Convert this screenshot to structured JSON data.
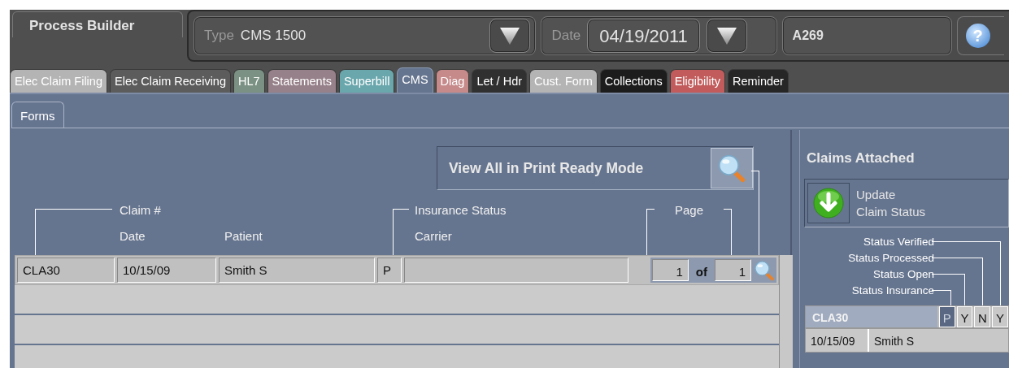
{
  "app": {
    "title": "Process Builder"
  },
  "header": {
    "type_label": "Type",
    "type_value": "CMS 1500",
    "date_label": "Date",
    "date_value": "04/19/2011",
    "code": "A269",
    "help": "?"
  },
  "tabs": [
    {
      "label": "Elec Claim Filing",
      "color": "#b4b4b4",
      "selected": false
    },
    {
      "label": "Elec Claim Receiving",
      "color": "#5c5c5c",
      "selected": false
    },
    {
      "label": "HL7",
      "color": "#7b9183",
      "selected": false
    },
    {
      "label": "Statements",
      "color": "#968089",
      "selected": false
    },
    {
      "label": "Superbill",
      "color": "#6aa7ad",
      "selected": false
    },
    {
      "label": "CMS",
      "color": "#66758f",
      "selected": true
    },
    {
      "label": "Diag",
      "color": "#c68a8a",
      "selected": false
    },
    {
      "label": "Let / Hdr",
      "color": "#303030",
      "selected": false
    },
    {
      "label": "Cust. Form",
      "color": "#b4b4b4",
      "selected": false
    },
    {
      "label": "Collections",
      "color": "#1c1c1c",
      "selected": false
    },
    {
      "label": "Eligibility",
      "color": "#c25c5c",
      "selected": false
    },
    {
      "label": "Reminder",
      "color": "#262626",
      "selected": false
    }
  ],
  "subtabs": [
    {
      "label": "Forms",
      "selected": true
    }
  ],
  "print_button": {
    "label": "View All in Print Ready Mode"
  },
  "columns": {
    "claim": "Claim #",
    "date": "Date",
    "patient": "Patient",
    "insurance_status": "Insurance Status",
    "carrier": "Carrier",
    "page": "Page"
  },
  "rows": [
    {
      "claim": "CLA30",
      "date": "10/15/09",
      "patient": "Smith S",
      "status": "P",
      "page": "1",
      "of": "of",
      "pages": "1"
    }
  ],
  "claims_panel": {
    "title": "Claims Attached",
    "update_lines": [
      "Update",
      "Claim Status"
    ],
    "status_labels": [
      "Status Verified",
      "Status Processed",
      "Status Open",
      "Status Insurance"
    ],
    "claims": [
      {
        "claim": "CLA30",
        "statuses": [
          {
            "value": "P",
            "selected": true
          },
          {
            "value": "Y",
            "selected": false
          },
          {
            "value": "N",
            "selected": false
          },
          {
            "value": "Y",
            "selected": false
          }
        ],
        "date": "10/15/09",
        "patient": "Smith S"
      }
    ]
  }
}
